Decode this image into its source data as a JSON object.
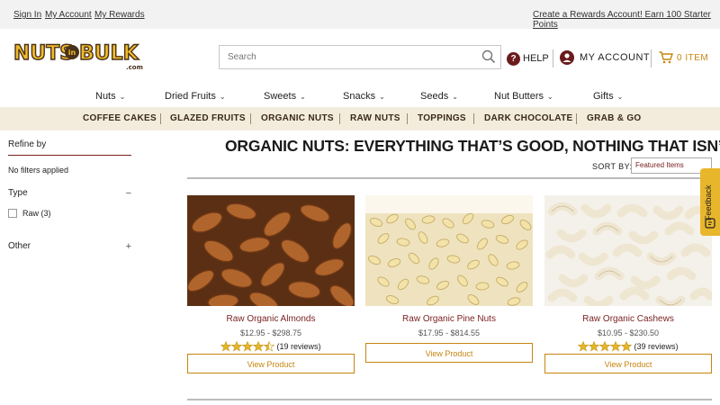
{
  "topbar": {
    "sign_in": "Sign In",
    "my_account": "My Account",
    "my_rewards": "My Rewards",
    "rewards_promo": "Create a Rewards Account! Earn 100 Starter Points"
  },
  "header": {
    "search_placeholder": "Search",
    "help": "HELP",
    "help_glyph": "?",
    "account": "MY ACCOUNT",
    "cart": "0 ITEM"
  },
  "main_nav": [
    "Nuts",
    "Dried Fruits",
    "Sweets",
    "Snacks",
    "Seeds",
    "Nut Butters",
    "Gifts"
  ],
  "sub_nav": [
    "COFFEE CAKES",
    "GLAZED FRUITS",
    "ORGANIC NUTS",
    "RAW NUTS",
    "TOPPINGS",
    "DARK CHOCOLATE",
    "GRAB & GO"
  ],
  "sidebar": {
    "refine_by": "Refine by",
    "no_filters": "No filters applied",
    "facets": [
      {
        "name": "Type",
        "toggle": "−"
      },
      {
        "name": "Other",
        "toggle": "+"
      }
    ],
    "type_options": [
      "Raw (3)"
    ]
  },
  "page": {
    "title": "ORGANIC NUTS: EVERYTHING THAT’S GOOD, NOTHING THAT ISN’T.",
    "sort_label": "SORT BY:",
    "sort_value": "Featured Items"
  },
  "products": [
    {
      "name": "Raw Organic Almonds",
      "price": "$12.95 - $298.75",
      "rating": 4.5,
      "reviews": "(19 reviews)",
      "button": "View Product"
    },
    {
      "name": "Raw Organic Pine Nuts",
      "price": "$17.95 - $814.55",
      "rating": null,
      "reviews": "",
      "button": "View Product"
    },
    {
      "name": "Raw Organic Cashews",
      "price": "$10.95 - $230.50",
      "rating": 5,
      "reviews": "(39 reviews)",
      "button": "View Product"
    }
  ],
  "feedback_tab": "Feedback",
  "colors": {
    "accent_gold": "#c6850e",
    "maroon": "#7a1f1f",
    "subnav_bg": "#f3ecdd",
    "star": "#e3b52a"
  }
}
